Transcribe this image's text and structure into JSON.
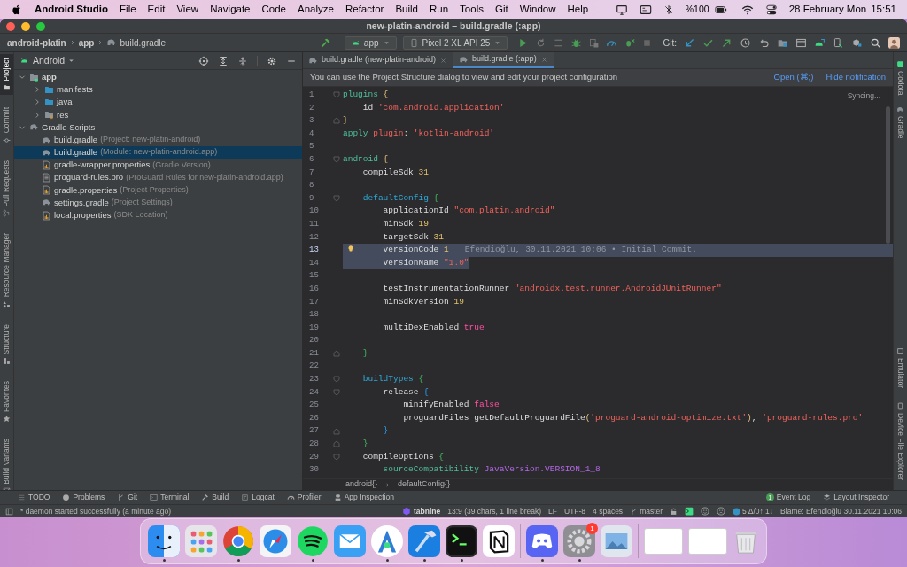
{
  "menu_bar": {
    "app": "Android Studio",
    "items": [
      "File",
      "Edit",
      "View",
      "Navigate",
      "Code",
      "Analyze",
      "Refactor",
      "Build",
      "Run",
      "Tools",
      "Git",
      "Window",
      "Help"
    ],
    "battery": "%100",
    "date": "28 February Mon",
    "time": "15:51"
  },
  "window": {
    "title": "new-platin-android – build.gradle (:app)"
  },
  "toolbar": {
    "breadcrumbs": [
      "android-platin",
      "app",
      "build.gradle"
    ],
    "run_config": "app",
    "device": "Pixel 2 XL API 25",
    "git_label": "Git:"
  },
  "left_strip": [
    {
      "label": "Project",
      "selected": true
    },
    {
      "label": "Commit",
      "selected": false
    },
    {
      "label": "Pull Requests",
      "selected": false
    },
    {
      "label": "Resource Manager",
      "selected": false
    },
    {
      "label": "Structure",
      "selected": false
    },
    {
      "label": "Favorites",
      "selected": false
    },
    {
      "label": "Build Variants",
      "selected": false
    }
  ],
  "project_panel": {
    "view": "Android",
    "tree": [
      {
        "label": "app",
        "kind": "module",
        "expanded": true,
        "selected": false,
        "children": [
          {
            "label": "manifests",
            "kind": "folder",
            "expanded": false,
            "selected": false
          },
          {
            "label": "java",
            "kind": "folder",
            "expanded": false,
            "selected": false
          },
          {
            "label": "res",
            "kind": "res",
            "expanded": false,
            "selected": false
          }
        ]
      },
      {
        "label": "Gradle Scripts",
        "kind": "gradle",
        "expanded": true,
        "selected": false,
        "children": [
          {
            "label": "build.gradle",
            "hint": "(Project: new-platin-android)",
            "kind": "gradle",
            "selected": false
          },
          {
            "label": "build.gradle",
            "hint": "(Module: new-platin-android.app)",
            "kind": "gradle",
            "selected": true
          },
          {
            "label": "gradle-wrapper.properties",
            "hint": "(Gradle Version)",
            "kind": "props",
            "selected": false
          },
          {
            "label": "proguard-rules.pro",
            "hint": "(ProGuard Rules for new-platin-android.app)",
            "kind": "file",
            "selected": false
          },
          {
            "label": "gradle.properties",
            "hint": "(Project Properties)",
            "kind": "props",
            "selected": false
          },
          {
            "label": "settings.gradle",
            "hint": "(Project Settings)",
            "kind": "gradle",
            "selected": false
          },
          {
            "label": "local.properties",
            "hint": "(SDK Location)",
            "kind": "props",
            "selected": false
          }
        ]
      }
    ]
  },
  "editor": {
    "tabs": [
      {
        "label": "build.gradle (new-platin-android)",
        "selected": false
      },
      {
        "label": "build.gradle (:app)",
        "selected": true
      }
    ],
    "notification": {
      "text": "You can use the Project Structure dialog to view and edit your project configuration",
      "actions": [
        "Open (⌘;)",
        "Hide notification"
      ]
    },
    "sync_status": "Syncing...",
    "blame": "Efendioğlu, 30.11.2021 10:06 • Initial Commit.",
    "lines": [
      {
        "n": "1",
        "kind": "open",
        "selected": false,
        "current": false,
        "tokens": [
          {
            "kind": "block",
            "text": "plugins"
          },
          {
            "kind": "brace_y",
            "text": " {"
          }
        ]
      },
      {
        "n": "2",
        "kind": "plain",
        "selected": false,
        "current": false,
        "tokens": [
          {
            "kind": "prop",
            "text": "    id"
          },
          {
            "kind": "str",
            "text": " 'com.android.application'"
          }
        ]
      },
      {
        "n": "3",
        "kind": "close",
        "selected": false,
        "current": false,
        "tokens": [
          {
            "kind": "brace_y",
            "text": "}"
          }
        ]
      },
      {
        "n": "4",
        "kind": "plain",
        "selected": false,
        "current": false,
        "tokens": [
          {
            "kind": "block",
            "text": "apply"
          },
          {
            "kind": "named_arg",
            "text": " plugin"
          },
          {
            "kind": "plain",
            "text": ":"
          },
          {
            "kind": "str",
            "text": " 'kotlin-android'"
          }
        ]
      },
      {
        "n": "5",
        "kind": "plain",
        "selected": false,
        "current": false
      },
      {
        "n": "6",
        "kind": "open",
        "selected": false,
        "current": false,
        "tokens": [
          {
            "kind": "block",
            "text": "android"
          },
          {
            "kind": "brace_y",
            "text": " {"
          }
        ]
      },
      {
        "n": "7",
        "kind": "plain",
        "selected": false,
        "current": false,
        "tokens": [
          {
            "kind": "prop",
            "text": "    compileSdk"
          },
          {
            "kind": "num",
            "text": " 31"
          }
        ]
      },
      {
        "n": "8",
        "kind": "plain",
        "selected": false,
        "current": false
      },
      {
        "n": "9",
        "kind": "open",
        "selected": false,
        "current": false,
        "tokens": [
          {
            "kind": "section",
            "text": "    defaultConfig"
          },
          {
            "kind": "brace_g",
            "text": " {"
          }
        ]
      },
      {
        "n": "10",
        "kind": "plain",
        "selected": false,
        "current": false,
        "tokens": [
          {
            "kind": "prop",
            "text": "        applicationId"
          },
          {
            "kind": "str",
            "text": " \"com.platin.android\""
          }
        ]
      },
      {
        "n": "11",
        "kind": "plain",
        "selected": false,
        "current": false,
        "tokens": [
          {
            "kind": "prop",
            "text": "        minSdk"
          },
          {
            "kind": "num",
            "text": " 19"
          }
        ]
      },
      {
        "n": "12",
        "kind": "plain",
        "selected": false,
        "current": false,
        "tokens": [
          {
            "kind": "prop",
            "text": "        targetSdk"
          },
          {
            "kind": "num",
            "text": " 31"
          }
        ]
      },
      {
        "n": "13",
        "kind": "plain",
        "selected": true,
        "current": true,
        "tokens": [
          {
            "kind": "prop",
            "text": "        versionCode"
          },
          {
            "kind": "num",
            "text": " 1"
          }
        ]
      },
      {
        "n": "14",
        "kind": "plain",
        "selected": true,
        "current": false,
        "tokens": [
          {
            "kind": "prop",
            "text": "        versionName"
          },
          {
            "kind": "str",
            "text": " \"1.0\""
          }
        ]
      },
      {
        "n": "15",
        "kind": "plain",
        "selected": false,
        "current": false
      },
      {
        "n": "16",
        "kind": "plain",
        "selected": false,
        "current": false,
        "tokens": [
          {
            "kind": "prop",
            "text": "        testInstrumentationRunner"
          },
          {
            "kind": "str",
            "text": " \"androidx.test.runner.AndroidJUnitRunner\""
          }
        ]
      },
      {
        "n": "17",
        "kind": "plain",
        "selected": false,
        "current": false,
        "tokens": [
          {
            "kind": "prop",
            "text": "        minSdkVersion"
          },
          {
            "kind": "num",
            "text": " 19"
          }
        ]
      },
      {
        "n": "18",
        "kind": "plain",
        "selected": false,
        "current": false
      },
      {
        "n": "19",
        "kind": "plain",
        "selected": false,
        "current": false,
        "tokens": [
          {
            "kind": "prop",
            "text": "        multiDexEnabled"
          },
          {
            "kind": "bool",
            "text": " true"
          }
        ]
      },
      {
        "n": "20",
        "kind": "plain",
        "selected": false,
        "current": false
      },
      {
        "n": "21",
        "kind": "close",
        "selected": false,
        "current": false,
        "tokens": [
          {
            "kind": "brace_g",
            "text": "    }"
          }
        ]
      },
      {
        "n": "22",
        "kind": "plain",
        "selected": false,
        "current": false
      },
      {
        "n": "23",
        "kind": "open",
        "selected": false,
        "current": false,
        "tokens": [
          {
            "kind": "section",
            "text": "    buildTypes"
          },
          {
            "kind": "brace_g",
            "text": " {"
          }
        ]
      },
      {
        "n": "24",
        "kind": "open",
        "selected": false,
        "current": false,
        "tokens": [
          {
            "kind": "prop",
            "text": "        release"
          },
          {
            "kind": "brace_b",
            "text": " {"
          }
        ]
      },
      {
        "n": "25",
        "kind": "plain",
        "selected": false,
        "current": false,
        "tokens": [
          {
            "kind": "prop",
            "text": "            minifyEnabled"
          },
          {
            "kind": "bool",
            "text": " false"
          }
        ]
      },
      {
        "n": "26",
        "kind": "plain",
        "selected": false,
        "current": false,
        "tokens": [
          {
            "kind": "prop",
            "text": "            proguardFiles getDefaultProguardFile"
          },
          {
            "kind": "brace_y",
            "text": "("
          },
          {
            "kind": "str",
            "text": "'proguard-android-optimize.txt'"
          },
          {
            "kind": "brace_y",
            "text": ")"
          },
          {
            "kind": "plain",
            "text": ","
          },
          {
            "kind": "str",
            "text": " 'proguard-rules.pro'"
          }
        ]
      },
      {
        "n": "27",
        "kind": "close",
        "selected": false,
        "current": false,
        "tokens": [
          {
            "kind": "brace_b",
            "text": "        }"
          }
        ]
      },
      {
        "n": "28",
        "kind": "close",
        "selected": false,
        "current": false,
        "tokens": [
          {
            "kind": "brace_g",
            "text": "    }"
          }
        ]
      },
      {
        "n": "29",
        "kind": "open",
        "selected": false,
        "current": false,
        "tokens": [
          {
            "kind": "prop",
            "text": "    compileOptions"
          },
          {
            "kind": "brace_g",
            "text": " {"
          }
        ]
      },
      {
        "n": "30",
        "kind": "plain",
        "selected": false,
        "current": false,
        "tokens": [
          {
            "kind": "block",
            "text": "        sourceCompatibility"
          },
          {
            "kind": "member",
            "text": " JavaVersion.VERSION_1_8"
          }
        ]
      }
    ],
    "breadcrumbs": [
      "android{}",
      "defaultConfig{}"
    ]
  },
  "right_strip": {
    "top": [
      "Codota",
      "Gradle"
    ],
    "bottom": [
      "Emulator",
      "Device File Explorer"
    ]
  },
  "bottom_tools": {
    "left": [
      "TODO",
      "Problems",
      "Git",
      "Terminal",
      "Build",
      "Logcat",
      "Profiler",
      "App Inspection"
    ],
    "event_log": {
      "label": "Event Log",
      "badge": "1"
    },
    "layout_inspector": "Layout Inspector"
  },
  "status_bar": {
    "message": "* daemon started successfully (a minute ago)",
    "plugin": "tabnine",
    "position": "13:9 (39 chars, 1 line break)",
    "line_sep": "LF",
    "encoding": "UTF-8",
    "indent": "4 spaces",
    "branch": "master",
    "changes": "5 Δ/0↑ 1↓",
    "blame": "Blame: Efendioğlu 30.11.2021 10:06"
  },
  "dock": {
    "badge": "1"
  }
}
